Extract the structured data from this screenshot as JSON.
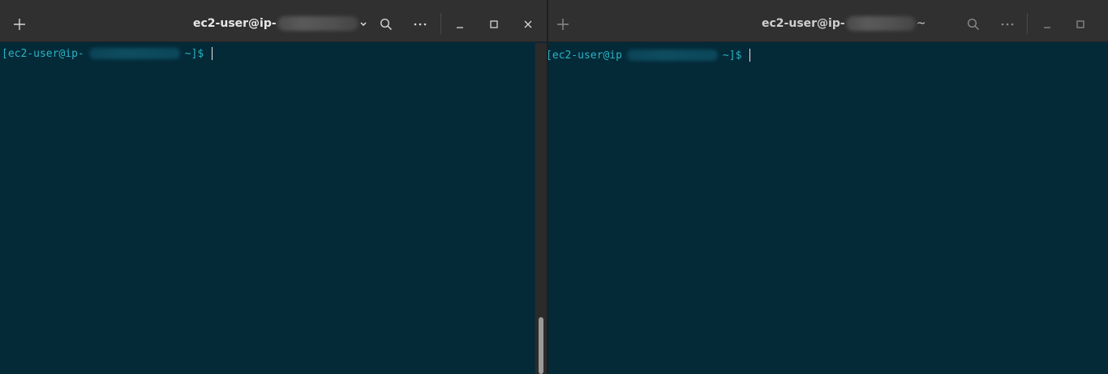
{
  "left_window": {
    "title_prefix": "ec2-user@ip-",
    "title_suffix": "",
    "prompt_prefix": "[ec2-user@ip-",
    "prompt_suffix": "~]$"
  },
  "right_window": {
    "title_prefix": "ec2-user@ip-",
    "title_suffix": "~",
    "prompt_prefix": "[ec2-user@ip",
    "prompt_suffix": "~]$"
  },
  "icons": {
    "new_tab": "plus-icon",
    "search": "search-icon",
    "menu": "ellipsis-icon",
    "minimize": "minimize-icon",
    "maximize": "maximize-icon",
    "close": "close-icon"
  },
  "colors": {
    "titlebar": "#303030",
    "terminal_bg": "#042a38",
    "prompt_text": "#2ab3c4",
    "title_text": "#e8e8e8"
  }
}
